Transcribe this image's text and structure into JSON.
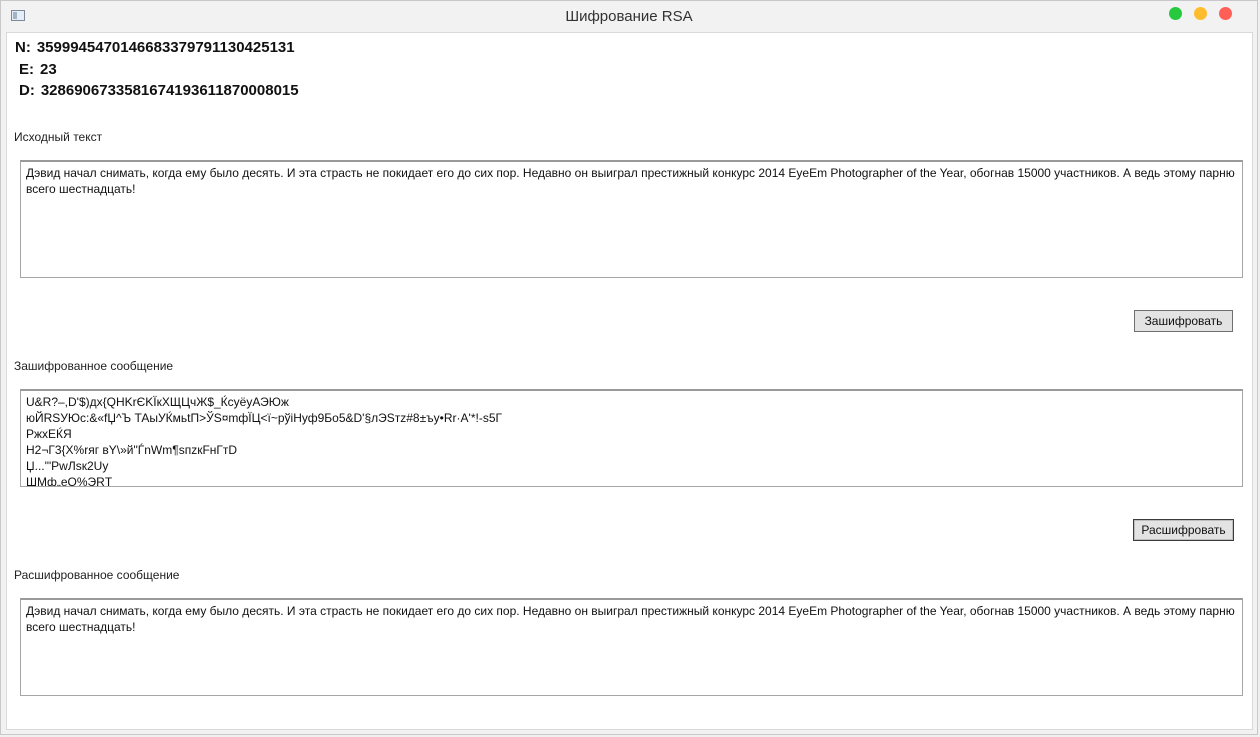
{
  "window": {
    "title": "Шифрование RSA"
  },
  "keys": {
    "n_label": "N:",
    "n_value": "35999454701466833797911304251 31",
    "e_label": "E:",
    "e_value": "23",
    "d_label": "D:",
    "d_value": "32869067335816741936118700080 15"
  },
  "source": {
    "label": "Исходный текст",
    "text": "Дэвид начал снимать, когда ему было десять. И эта страсть не покидает его до сих пор. Недавно он выиграл престижный конкурс 2014 EyeEm Photographer of the Year, обогнав 15000 участников. А ведь этому парню всего шестнадцать!"
  },
  "encrypt_button": "Зашифровать",
  "cipher": {
    "label": "Зашифрованное сообщение",
    "text": "U&R?–,D'$)дх{QHKrЄKЇкXЩЦчЖ$_ЌсуёуАЭЮж\nюЙRSУЮс:&«fЏ^Ъ ТАыУЌмьtП>ЎЅ¤mфЇЦ<ї~рўіНуф9Бо5&D'§лЭЅтz#8±ъу•Rr·А'*!-s5Г\nРжхЕЌЯ\nН2¬Г3{Х%rяг вY\\»й\"ЃnWm¶ѕпzкFнГтD\nЏ...'\"PwЛѕк2Uy\nШМф„еQ%ЭRТ"
  },
  "decrypt_button": "Расшифровать",
  "decrypted": {
    "label": "Расшифрованное сообщение",
    "text": "Дэвид начал снимать, когда ему было десять. И эта страсть не покидает его до сих пор. Недавно он выиграл престижный конкурс 2014 EyeEm Photographer of the Year, обогнав 15000 участников. А ведь этому парню всего шестнадцать!"
  },
  "colors": {
    "window_bg": "#f2f2f2",
    "client_bg": "#ffffff",
    "btn_bg": "#e3e3e3",
    "traffic_green": "#27c93f",
    "traffic_yellow": "#ffbd2e",
    "traffic_red": "#ff5f56"
  }
}
